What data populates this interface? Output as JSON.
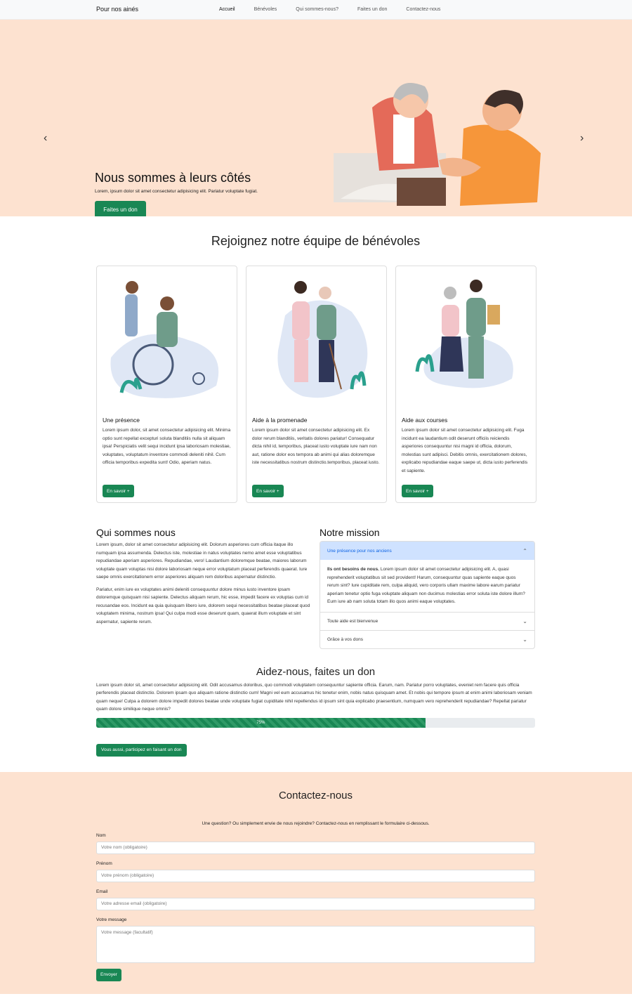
{
  "nav": {
    "brand": "Pour nos ainés",
    "links": [
      "Accueil",
      "Bénévoles",
      "Qui sommes-nous?",
      "Faites un don",
      "Contactez-nous"
    ]
  },
  "hero": {
    "title": "Nous sommes à leurs côtés",
    "text": "Lorem, ipsum dolor sit amet consectetur adipisicing elit. Pariatur voluptate fugiat.",
    "button": "Faites un don",
    "prev_icon": "chevron-left-icon",
    "next_icon": "chevron-right-icon"
  },
  "volunteers": {
    "title": "Rejoignez notre équipe de bénévoles",
    "cards": [
      {
        "title": "Une présence",
        "text": "Lorem ipsum dolor, sit amet consectetur adipisicing elit. Minima optio sunt repellat excepturi soluta blanditiis nulla sit aliquam ipsa! Perspiciatis velit sequi incidunt ipsa laboriosam molestiae, voluptates, voluptatum inventore commodi deleniti nihil. Cum officia temporibus expedita sunt! Odio, aperiam natus.",
        "button": "En savoir +"
      },
      {
        "title": "Aide à la promenade",
        "text": "Lorem ipsum dolor sit amet consectetur adipisicing elit. Ex dolor rerum blanditiis, veritatis dolores pariatur! Consequatur dicta nihil id, temporibus, placeat iusto voluptate iure nam non aut, ratione dolor eos tempora ab animi qui alias doloremque iste necessitatibus nostrum distinctio.temporibus, placeat iusto.",
        "button": "En savoir +"
      },
      {
        "title": "Aide aux courses",
        "text": "Lorem ipsum dolor sit amet consectetur adipisicing elit. Fuga incidunt ea laudantium odit deserunt officiis reiciendis asperiores consequuntur nisi magni id officia, dolorum, molestias sunt adipisci. Debitis omnis, exercitationem dolores, explicabo repudiandae eaque saepe ut, dicta iusto perferendis et sapiente.",
        "button": "En savoir +"
      }
    ]
  },
  "who": {
    "title": "Qui sommes nous",
    "p1": "Lorem ipsum, dolor sit amet consectetur adipisicing elit. Dolorum asperiores cum officia itaque illo numquam ipsa assumenda. Delectus iste, molestiae in natus voluptates nemo amet esse voluptatibus repudiandae aperiam asperiores. Repudiandae, vero! Laudantium doloremque beatae, maiores laborum voluptate quam voluptas nisi dolore laboriosam neque error voluptatum placeat perferendis quaerat. Iure saepe omnis exercitationem error asperiores aliquam rem doloribus aspernatur distinctio.",
    "p2": "Pariatur, enim iure ex voluptates animi deleniti consequuntur dolore minus iusto inventore ipsam doloremque quisquam nisi sapiente. Delectus aliquam rerum, hic esse, impedit facere ex voluptas cum id recusandae eos. Incidunt ea quia quisquam libero iure, dolorem sequi necessitatibus beatae placeat quod voluptatem minima, nostrum ipsa! Qui culpa modi esse deserunt quam, quaerat illum voluptate et sint aspernatur, sapiente rerum."
  },
  "mission": {
    "title": "Notre mission",
    "items": [
      {
        "header": "Une présence pour nos anciens",
        "body_bold": "Ils ont besoins de nous.",
        "body": " Lorem ipsum dolor sit amet consectetur adipisicing elit. A, quasi reprehenderit voluptatibus sit sed provident! Harum, consequuntur quas sapiente eaque quos rerum sint? Iure cupiditate rem, culpa aliquid, vero corporis ullam maxime labore earum pariatur aperiam tenetur optio fuga voluptate aliquam non ducimus molestias error soluta iste dolore illum? Eum iure ab nam soluta totam illo quos animi eaque voluptates."
      },
      {
        "header": "Toute aide est bienvenue"
      },
      {
        "header": "Grâce à vos dons"
      }
    ]
  },
  "donate": {
    "title": "Aidez-nous, faites un don",
    "text": "Lorem ipsum dolor sit, amet consectetur adipisicing elit. Odit accusamus doloribus, quo commodi voluptatem consequuntur sapiente officia. Earum, nam. Pariatur porro voluptates, eveniet rem facere quis officia perferendis placeat distinctio. Dolorem ipsam quo aliquam ratione distinctio cum! Magni vel eum accusamus hic tenetur enim, nobis natus quisquam amet. Et nobis qui tempore ipsum at enim animi laboriosam veniam quam neque! Culpa a dolorem dolore impedit dolores beatae unde voluptate fugiat cupiditate nihil repellendus id ipsum sint quia explicabo praesentium, numquam vero reprehenderit repudiandae? Repellat pariatur quam dolore similique neque omnis?",
    "progress_label": "75%",
    "progress_value": 0.75,
    "button": "Vous aussi, participez en faisant un don"
  },
  "contact": {
    "title": "Contactez-nous",
    "intro": "Une question? Ou simplement envie de nous rejoindre? Contactez-nous en remplissant le formulaire ci-dessous.",
    "fields": [
      {
        "label": "Nom",
        "placeholder": "Votre nom (obligatoire)"
      },
      {
        "label": "Prénom",
        "placeholder": "Votre prénom (obligatoire)"
      },
      {
        "label": "Email",
        "placeholder": "Votre adresse email (obligatoire)"
      },
      {
        "label": "Votre message",
        "placeholder": "Votre message (facultatif)"
      }
    ],
    "button": "Envoyer"
  },
  "colors": {
    "accent": "#198754",
    "peach": "#fde2d0",
    "accordion_open": "#cfe2ff"
  }
}
